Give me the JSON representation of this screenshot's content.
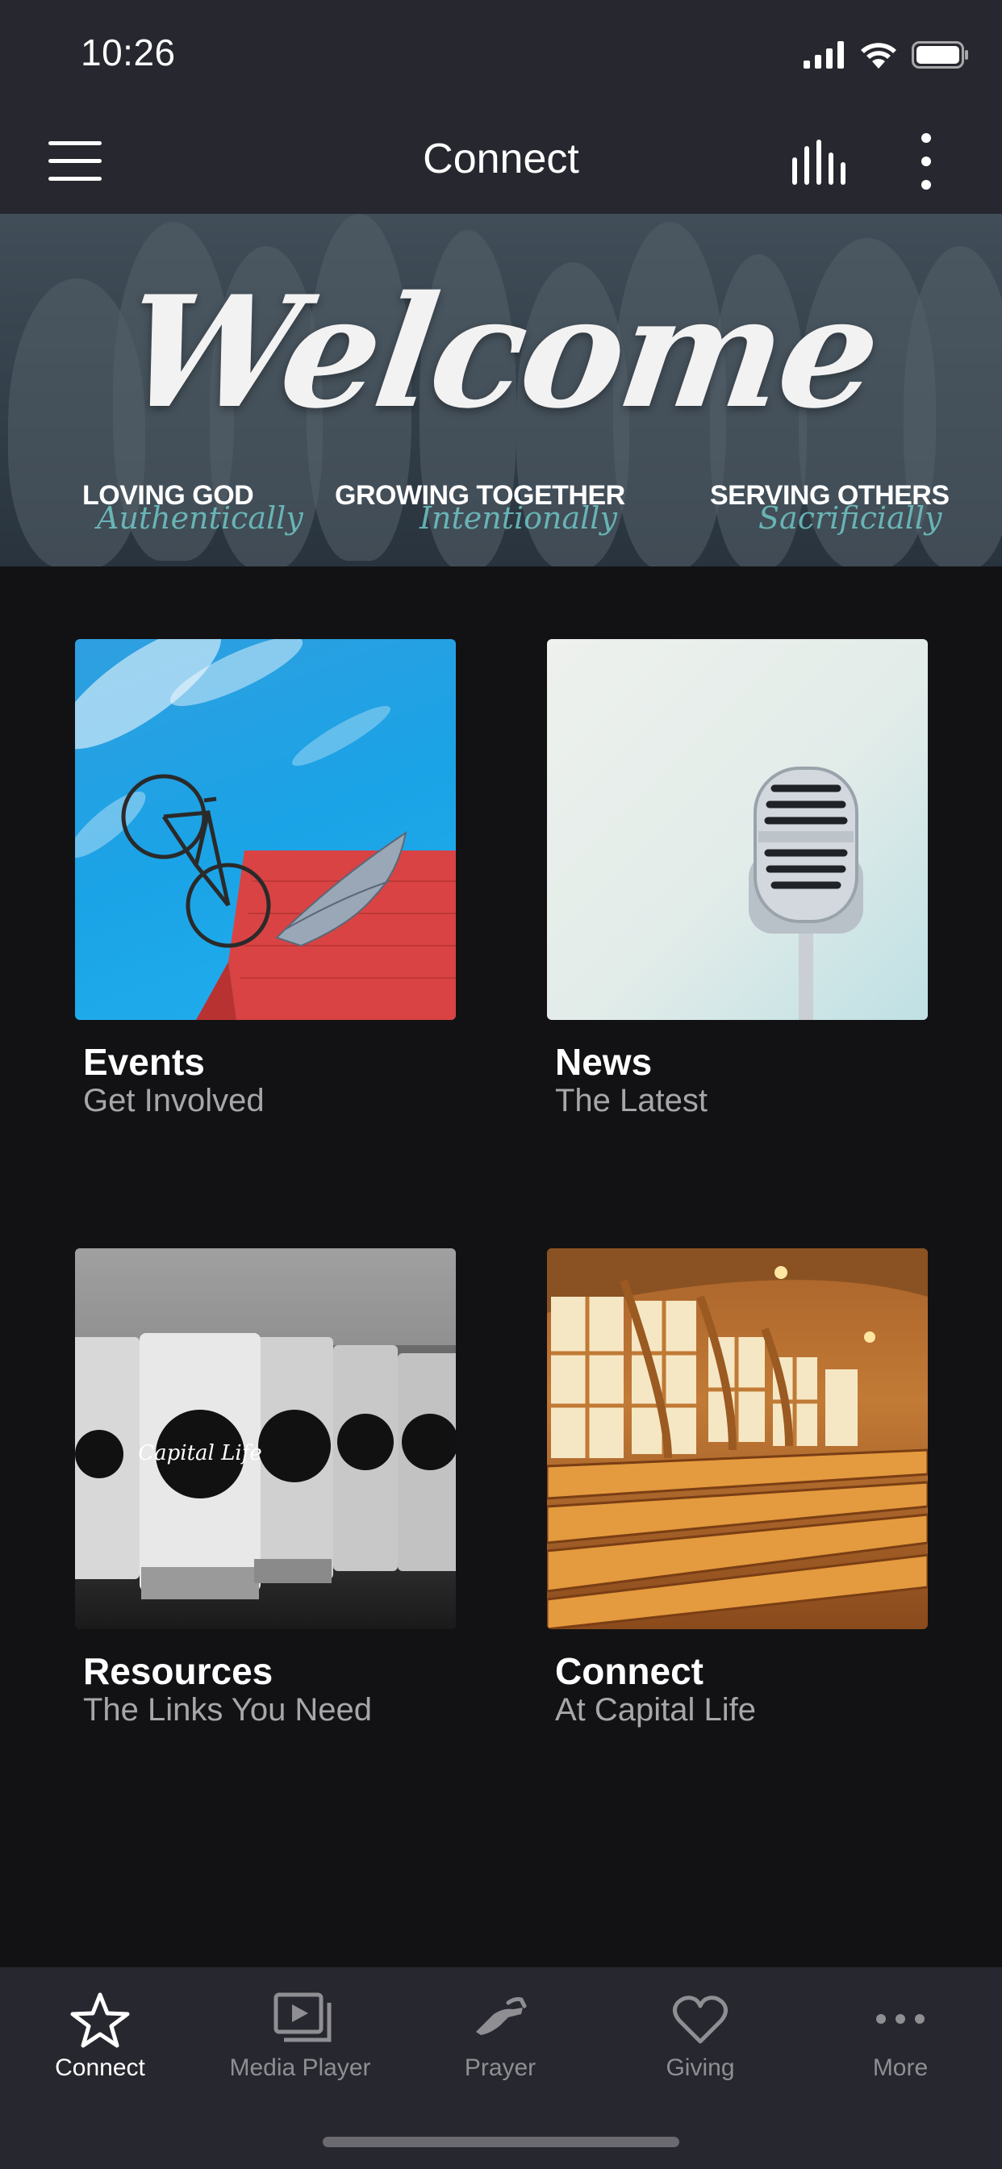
{
  "status_bar": {
    "time": "10:26"
  },
  "nav": {
    "title": "Connect"
  },
  "banner": {
    "headline": "Welcome",
    "taglines": [
      {
        "main": "LOVING GOD",
        "sub": "Authentically"
      },
      {
        "main": "GROWING TOGETHER",
        "sub": "Intentionally"
      },
      {
        "main": "SERVING OTHERS",
        "sub": "Sacrificially"
      }
    ]
  },
  "cards": [
    {
      "title": "Events",
      "subtitle": "Get Involved"
    },
    {
      "title": "News",
      "subtitle": "The Latest"
    },
    {
      "title": "Resources",
      "subtitle": "The Links You Need",
      "cup_text": "Capital Life"
    },
    {
      "title": "Connect",
      "subtitle": "At Capital Life"
    }
  ],
  "tab_bar": {
    "tabs": [
      {
        "label": "Connect",
        "icon": "star-icon",
        "active": true
      },
      {
        "label": "Media Player",
        "icon": "media-player-icon",
        "active": false
      },
      {
        "label": "Prayer",
        "icon": "prayer-hands-icon",
        "active": false
      },
      {
        "label": "Giving",
        "icon": "heart-icon",
        "active": false
      },
      {
        "label": "More",
        "icon": "more-dots-icon",
        "active": false
      }
    ]
  },
  "colors": {
    "bars": "#27272f",
    "background": "#121214",
    "inactive": "#8e8e93",
    "accent_script": "#6fc6c6"
  }
}
